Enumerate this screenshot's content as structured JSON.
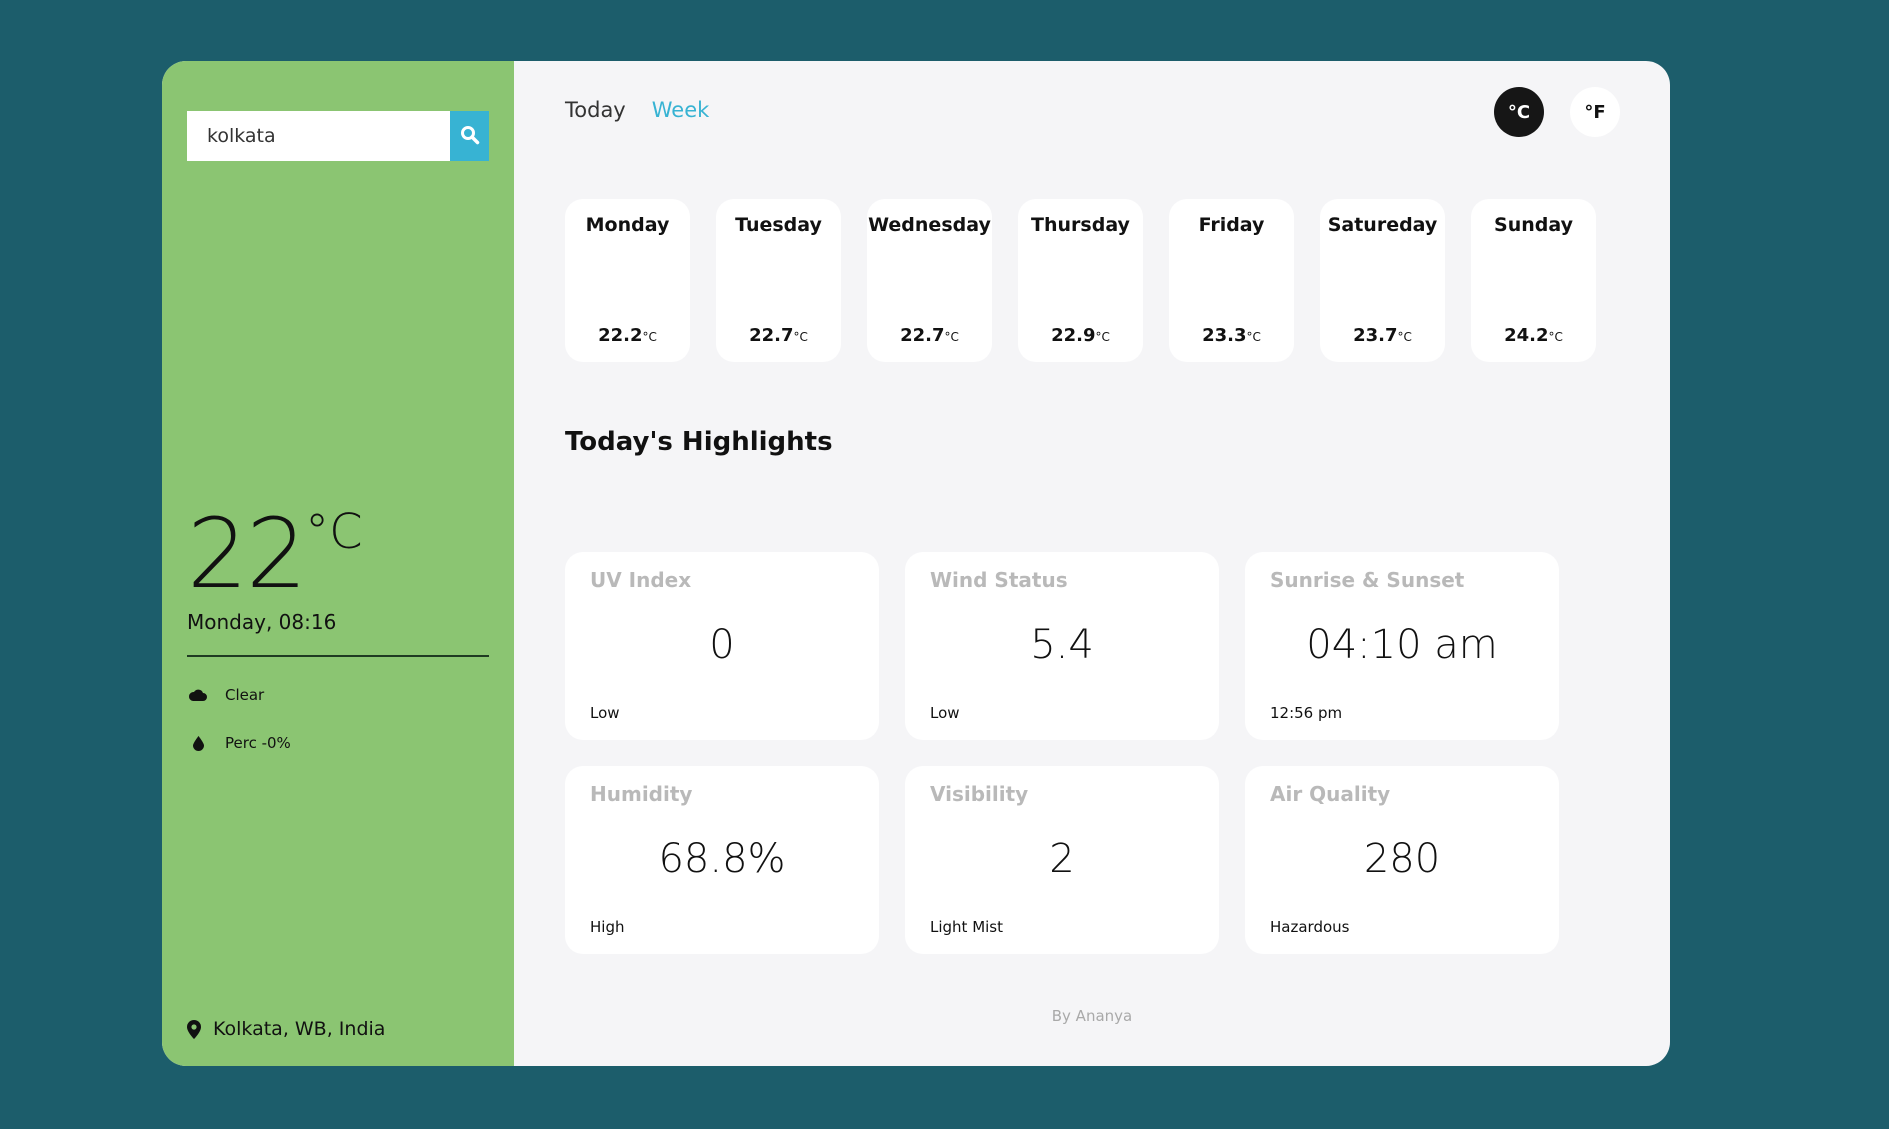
{
  "search": {
    "value": "kolkata",
    "icon": "search-icon"
  },
  "current": {
    "temp": "22",
    "unit": "°C",
    "datetime": "Monday, 08:16",
    "condition": "Clear",
    "precipitation": "Perc -0%",
    "location": "Kolkata, WB, India"
  },
  "tabs": {
    "today": "Today",
    "week": "Week"
  },
  "units": {
    "celsius": "°C",
    "fahrenheit": "°F"
  },
  "week": [
    {
      "day": "Monday",
      "temp": "22.2",
      "unit": "°C"
    },
    {
      "day": "Tuesday",
      "temp": "22.7",
      "unit": "°C"
    },
    {
      "day": "Wednesday",
      "temp": "22.7",
      "unit": "°C"
    },
    {
      "day": "Thursday",
      "temp": "22.9",
      "unit": "°C"
    },
    {
      "day": "Friday",
      "temp": "23.3",
      "unit": "°C"
    },
    {
      "day": "Satureday",
      "temp": "23.7",
      "unit": "°C"
    },
    {
      "day": "Sunday",
      "temp": "24.2",
      "unit": "°C"
    }
  ],
  "highlights": {
    "title": "Today's Highlights",
    "cards": [
      {
        "title": "UV Index",
        "value": "0",
        "sub": "Low"
      },
      {
        "title": "Wind Status",
        "value": "5.4",
        "sub": "Low"
      },
      {
        "title": "Sunrise & Sunset",
        "value": "04:10 am",
        "sub": "12:56 pm"
      },
      {
        "title": "Humidity",
        "value": "68.8%",
        "sub": "High"
      },
      {
        "title": "Visibility",
        "value": "2",
        "sub": "Light Mist"
      },
      {
        "title": "Air Quality",
        "value": "280",
        "sub": "Hazardous"
      }
    ]
  },
  "credit": "By Ananya",
  "colors": {
    "background": "#1c5d6b",
    "sidebar": "#8bc572",
    "accent": "#37b3d3",
    "active_unit": "#161616"
  }
}
